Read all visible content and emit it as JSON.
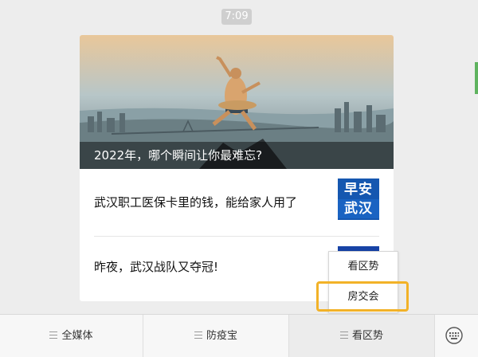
{
  "time": "7:09",
  "hero": {
    "title": "2022年，哪个瞬间让你最难忘?"
  },
  "articles": [
    {
      "title": "武汉职工医保卡里的钱，能给家人用了",
      "thumb_top": "早安",
      "thumb_bottom": "武汉"
    },
    {
      "title": "昨夜，武汉战队又夺冠!"
    }
  ],
  "popup": {
    "items": [
      "看区势",
      "房交会"
    ]
  },
  "bottom_menu": {
    "items": [
      "全媒体",
      "防疫宝",
      "看区势"
    ],
    "keyboard_icon": "keyboard-icon"
  },
  "colors": {
    "highlight": "#f2b228",
    "thumb_blue": "#1557b0"
  }
}
